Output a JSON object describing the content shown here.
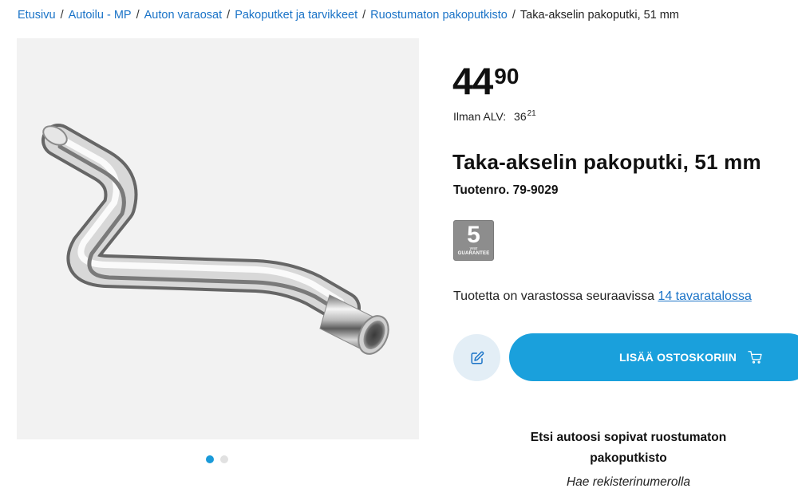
{
  "breadcrumb": {
    "items": [
      "Etusivu",
      "Autoilu - MP",
      "Auton varaosat",
      "Pakoputket ja tarvikkeet",
      "Ruostumaton pakoputkisto"
    ],
    "separator": "/",
    "current": "Taka-akselin pakoputki, 51 mm"
  },
  "product": {
    "price_main": "44",
    "price_cents": "90",
    "vat_label": "Ilman ALV:",
    "vat_main": "36",
    "vat_cents": "21",
    "title": "Taka-akselin pakoputki, 51 mm",
    "sku": "Tuotenro. 79-9029"
  },
  "guarantee": {
    "years": "5",
    "unit": "year",
    "word": "GUARANTEE"
  },
  "stock": {
    "text": "Tuotetta on varastossa seuraavissa",
    "link": "14 tavaratalossa"
  },
  "actions": {
    "edit_icon": "edit-icon",
    "add_to_cart": "LISÄÄ OSTOSKORIIN",
    "cart_icon": "cart-icon"
  },
  "gallery": {
    "image_alt": "exhaust-pipe-image",
    "slide_count": 2,
    "active_slide": 1
  },
  "finder": {
    "heading": "Etsi autoosi sopivat ruostumaton pakoputkisto",
    "sub": "Hae rekisterinumerolla"
  },
  "colors": {
    "accent": "#1aa0dc",
    "link": "#1a73c7",
    "edit_bg": "#e3eef6",
    "gallery_bg": "#f2f2f2"
  }
}
